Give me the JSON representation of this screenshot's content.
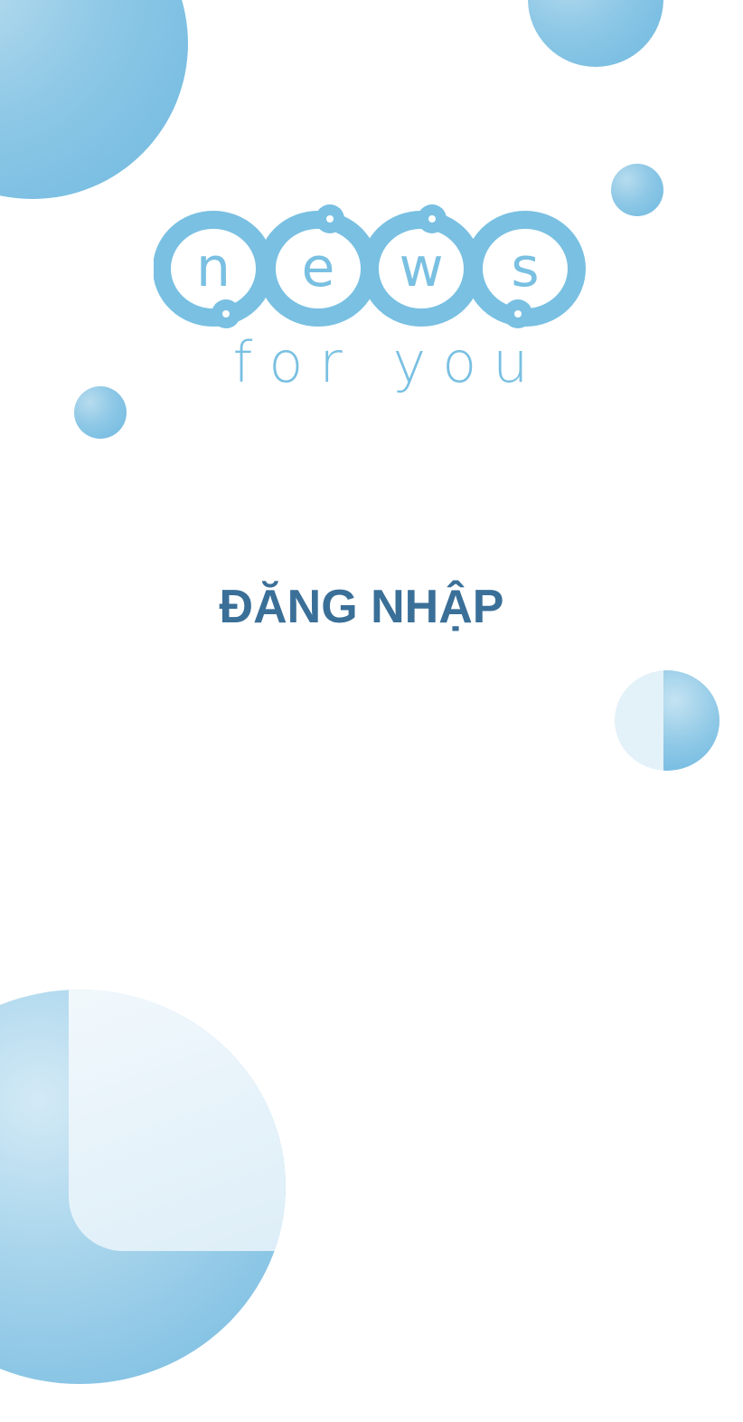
{
  "logo": {
    "letters": [
      "n",
      "e",
      "w",
      "s"
    ],
    "subtitle": "for you"
  },
  "title": "ĐĂNG NHẬP",
  "colors": {
    "accent": "#79c0e2",
    "title": "#3a6f98",
    "bubble": "#8ec8e6"
  }
}
